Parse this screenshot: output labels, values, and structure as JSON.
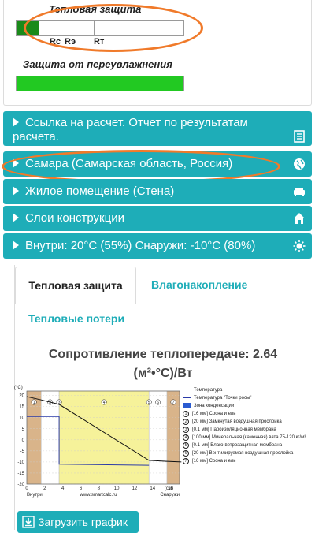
{
  "thermal": {
    "title": "Тепловая защита",
    "markers": [
      "Rс",
      "Rэ",
      "Rт"
    ]
  },
  "moisture": {
    "title": "Защита от переувлажнения"
  },
  "accordion": [
    {
      "label": "Ссылка на расчет. Отчет по результатам расчета.",
      "icon": "report-icon"
    },
    {
      "label": "Самара (Самарская область, Россия)",
      "icon": "globe-icon"
    },
    {
      "label": "Жилое помещение (Стена)",
      "icon": "sofa-icon"
    },
    {
      "label": "Слои конструкции",
      "icon": "home-icon"
    },
    {
      "label": "Внутри: 20°C (55%) Снаружи: -10°C (80%)",
      "icon": "sun-icon"
    }
  ],
  "tabs": [
    {
      "label": "Тепловая защита",
      "active": true
    },
    {
      "label": "Влагонакопление",
      "active": false
    },
    {
      "label": "Тепловые потери",
      "active": false
    }
  ],
  "result": {
    "line1": "Сопротивление теплопередаче: 2.64",
    "line2": "(м²•°С)/Вт"
  },
  "chart": {
    "unit_y": "(°C)",
    "unit_x": "(см)",
    "label_inside": "Внутри",
    "label_outside": "Снаружи",
    "site": "www.smartcalc.ru",
    "yticks": [
      "20",
      "15",
      "10",
      "5",
      "0",
      "-5",
      "-10",
      "-15",
      "-20"
    ],
    "xticks": [
      "0",
      "2",
      "4",
      "6",
      "8",
      "10",
      "12",
      "14",
      "16"
    ],
    "layer_nums": [
      "1",
      "2",
      "3",
      "4",
      "5",
      "6",
      "7"
    ],
    "legend": [
      "Температура",
      "Температура \"Точки росы\"",
      "Зона конденсации",
      "[16 мм] Сосна и ель",
      "[20 мм] Замкнутая воздушная прослойка",
      "[0.1 мм] Пароизоляционная мембрана",
      "[100 мм] Минеральная (каменная) вата 75-120 кг/м³",
      "[0.1 мм] Влаго-ветрозащитная мембрана",
      "[20 мм] Вентилируемая воздушная прослойка",
      "[16 мм] Сосна и ель"
    ]
  },
  "button": {
    "label": "Загрузить график"
  },
  "colors": {
    "accent": "#1eadb8",
    "bar_dark": "#1a8a1a",
    "bar_light": "#22c922",
    "highlight": "#f07a2a"
  },
  "chart_data": {
    "type": "line",
    "xlabel": "(см)",
    "ylabel": "(°C)",
    "xlim": [
      0,
      17
    ],
    "ylim": [
      -20,
      22
    ],
    "series": [
      {
        "name": "Температура",
        "x": [
          0,
          1.6,
          3.6,
          3.6,
          13.6,
          15.6,
          17.2
        ],
        "y": [
          19.5,
          18.0,
          16.0,
          16.0,
          -9.3,
          -9.7,
          -10.0
        ]
      },
      {
        "name": "Температура \"Точки росы\"",
        "x": [
          0,
          3.6,
          3.6,
          13.6,
          13.6
        ],
        "y": [
          10.5,
          10.5,
          -11.0,
          -11.5,
          -11.5
        ]
      }
    ]
  }
}
